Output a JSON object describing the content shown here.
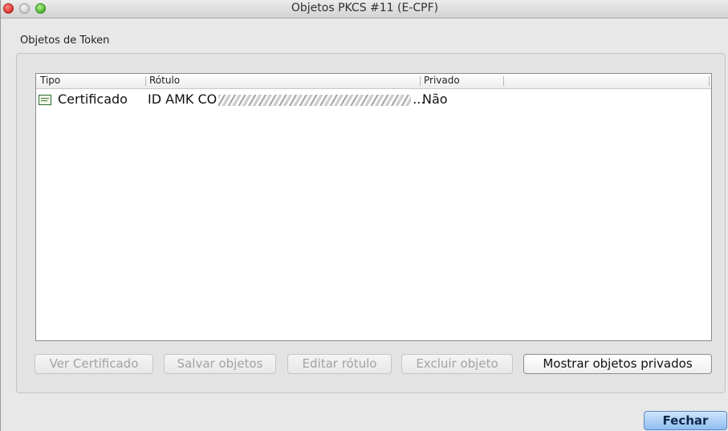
{
  "window": {
    "title": "Objetos PKCS #11 (E-CPF)"
  },
  "tab": {
    "label": "Objetos de Token"
  },
  "table": {
    "columns": [
      "Tipo",
      "Rótulo",
      "Privado"
    ],
    "rows": [
      {
        "tipo": "Certificado",
        "rotulo_prefix": "ID AMK CO",
        "rotulo_suffix": "...",
        "privado": "Não",
        "icon": "certificate-icon"
      }
    ]
  },
  "buttons": {
    "ver_certificado": "Ver Certificado",
    "salvar_objetos": "Salvar objetos",
    "editar_rotulo": "Editar rótulo",
    "excluir_objeto": "Excluir objeto",
    "mostrar_privados": "Mostrar objetos privados",
    "fechar": "Fechar"
  }
}
